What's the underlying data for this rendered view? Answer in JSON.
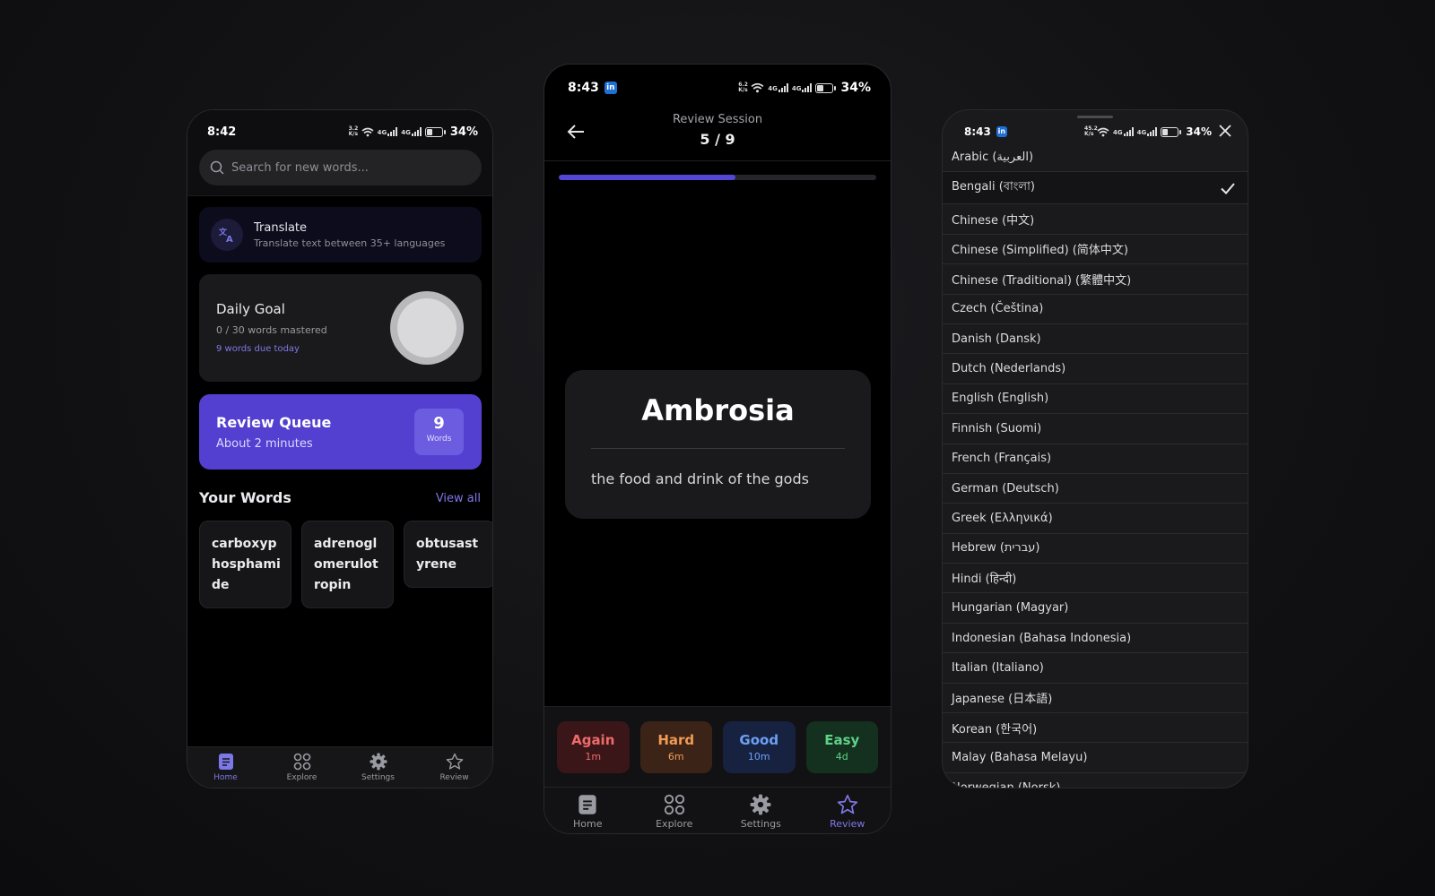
{
  "home": {
    "status": {
      "time": "8:42",
      "net_top": "3.2",
      "net_bottom": "K/s",
      "g1": "4G",
      "g2": "4G",
      "battery": "34%"
    },
    "search_placeholder": "Search for new words...",
    "translate": {
      "title": "Translate",
      "subtitle": "Translate text between 35+ languages"
    },
    "goal": {
      "title": "Daily Goal",
      "progress": "0 / 30 words mastered",
      "due": "9 words due today",
      "mastered": 0,
      "target": 30
    },
    "queue": {
      "title": "Review Queue",
      "subtitle": "About 2 minutes",
      "count": "9",
      "count_label": "Words"
    },
    "your_words": {
      "title": "Your Words",
      "view_all": "View all"
    },
    "words": [
      "carboxyphosphamide",
      "adrenoglomerulotropin",
      "obtusastyrene"
    ],
    "nav": [
      "Home",
      "Explore",
      "Settings",
      "Review"
    ]
  },
  "review": {
    "status": {
      "time": "8:43",
      "li": "in",
      "net_top": "6.2",
      "net_bottom": "K/s",
      "g1": "4G",
      "g2": "4G",
      "battery": "34%"
    },
    "title": "Review Session",
    "count": "5 / 9",
    "progress": 0.556,
    "card": {
      "word": "Ambrosia",
      "definition": "the food and drink of the gods"
    },
    "answers": [
      {
        "label": "Again",
        "time": "1m"
      },
      {
        "label": "Hard",
        "time": "6m"
      },
      {
        "label": "Good",
        "time": "10m"
      },
      {
        "label": "Easy",
        "time": "4d"
      }
    ],
    "nav": [
      "Home",
      "Explore",
      "Settings",
      "Review"
    ]
  },
  "languages": {
    "status": {
      "time": "8:43",
      "li": "in",
      "net_top": "45.2",
      "net_bottom": "K/s",
      "g1": "4G",
      "g2": "4G",
      "battery": "34%"
    },
    "selected": "Bengali (বাংলা)",
    "items": [
      "Arabic (العربية)",
      "Bengali (বাংলা)",
      "Chinese (中文)",
      "Chinese (Simplified) (简体中文)",
      "Chinese (Traditional) (繁體中文)",
      "Czech (Čeština)",
      "Danish (Dansk)",
      "Dutch (Nederlands)",
      "English (English)",
      "Finnish (Suomi)",
      "French (Français)",
      "German (Deutsch)",
      "Greek (Ελληνικά)",
      "Hebrew (עברית)",
      "Hindi (हिन्दी)",
      "Hungarian (Magyar)",
      "Indonesian (Bahasa Indonesia)",
      "Italian (Italiano)",
      "Japanese (日本語)",
      "Korean (한국어)",
      "Malay (Bahasa Melayu)",
      "Norwegian (Norsk)"
    ]
  },
  "colors": {
    "accent": "#5340d0",
    "accent_text": "#7d78e8",
    "again": "#ef6a6a",
    "hard": "#f09a55",
    "good": "#6da0f5",
    "easy": "#5fd189"
  }
}
